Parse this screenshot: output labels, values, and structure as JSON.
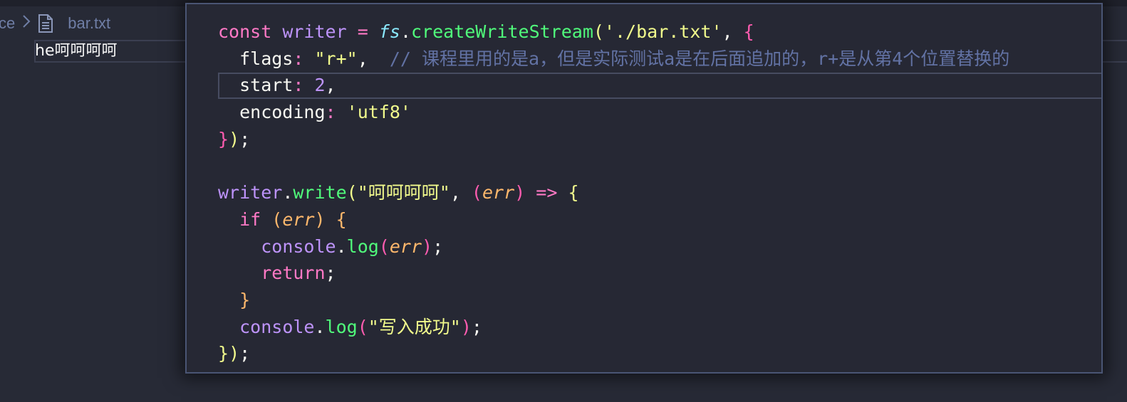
{
  "background_editor": {
    "breadcrumb_prev": "ce",
    "breadcrumb_file": "bar.txt",
    "file_content": "he呵呵呵呵"
  },
  "peek": {
    "lines": [
      {
        "tokens": [
          {
            "t": "const",
            "c": "kw"
          },
          {
            "t": " ",
            "c": "pun"
          },
          {
            "t": "writer",
            "c": "var"
          },
          {
            "t": " ",
            "c": "pun"
          },
          {
            "t": "=",
            "c": "op"
          },
          {
            "t": " ",
            "c": "pun"
          },
          {
            "t": "fs",
            "c": "obj"
          },
          {
            "t": ".",
            "c": "pun"
          },
          {
            "t": "createWriteStream",
            "c": "fn"
          },
          {
            "t": "(",
            "c": "p1"
          },
          {
            "t": "'./bar.txt'",
            "c": "str"
          },
          {
            "t": ", ",
            "c": "pun"
          },
          {
            "t": "{",
            "c": "p2"
          }
        ]
      },
      {
        "tokens": [
          {
            "t": "  flags",
            "c": "prop"
          },
          {
            "t": ":",
            "c": "op"
          },
          {
            "t": " ",
            "c": "pun"
          },
          {
            "t": "\"r+\"",
            "c": "str"
          },
          {
            "t": ",  ",
            "c": "pun"
          },
          {
            "t": "// 课程里用的是a，但是实际测试a是在后面追加的，r+是从第4个位置替换的",
            "c": "cmt"
          }
        ]
      },
      {
        "tokens": [
          {
            "t": "  start",
            "c": "prop"
          },
          {
            "t": ":",
            "c": "op"
          },
          {
            "t": " ",
            "c": "pun"
          },
          {
            "t": "2",
            "c": "num"
          },
          {
            "t": ",",
            "c": "pun"
          }
        ]
      },
      {
        "tokens": [
          {
            "t": "  encoding",
            "c": "prop"
          },
          {
            "t": ":",
            "c": "op"
          },
          {
            "t": " ",
            "c": "pun"
          },
          {
            "t": "'utf8'",
            "c": "str"
          }
        ]
      },
      {
        "tokens": [
          {
            "t": "}",
            "c": "p2"
          },
          {
            "t": ")",
            "c": "p1"
          },
          {
            "t": ";",
            "c": "pun"
          }
        ]
      },
      {
        "tokens": [
          {
            "t": "",
            "c": "pun"
          }
        ]
      },
      {
        "tokens": [
          {
            "t": "writer",
            "c": "var"
          },
          {
            "t": ".",
            "c": "pun"
          },
          {
            "t": "write",
            "c": "fn"
          },
          {
            "t": "(",
            "c": "p1"
          },
          {
            "t": "\"呵呵呵呵\"",
            "c": "str"
          },
          {
            "t": ", ",
            "c": "pun"
          },
          {
            "t": "(",
            "c": "p2"
          },
          {
            "t": "err",
            "c": "param"
          },
          {
            "t": ")",
            "c": "p2"
          },
          {
            "t": " ",
            "c": "pun"
          },
          {
            "t": "=>",
            "c": "op"
          },
          {
            "t": " ",
            "c": "pun"
          },
          {
            "t": "{",
            "c": "p1"
          }
        ]
      },
      {
        "tokens": [
          {
            "t": "  ",
            "c": "pun"
          },
          {
            "t": "if",
            "c": "kw"
          },
          {
            "t": " ",
            "c": "pun"
          },
          {
            "t": "(",
            "c": "p3"
          },
          {
            "t": "err",
            "c": "param"
          },
          {
            "t": ")",
            "c": "p3"
          },
          {
            "t": " ",
            "c": "pun"
          },
          {
            "t": "{",
            "c": "p3"
          }
        ]
      },
      {
        "tokens": [
          {
            "t": "    ",
            "c": "pun"
          },
          {
            "t": "console",
            "c": "var"
          },
          {
            "t": ".",
            "c": "pun"
          },
          {
            "t": "log",
            "c": "fn"
          },
          {
            "t": "(",
            "c": "p2"
          },
          {
            "t": "err",
            "c": "param"
          },
          {
            "t": ")",
            "c": "p2"
          },
          {
            "t": ";",
            "c": "pun"
          }
        ]
      },
      {
        "tokens": [
          {
            "t": "    ",
            "c": "pun"
          },
          {
            "t": "return",
            "c": "kw"
          },
          {
            "t": ";",
            "c": "pun"
          }
        ]
      },
      {
        "tokens": [
          {
            "t": "  ",
            "c": "pun"
          },
          {
            "t": "}",
            "c": "p3"
          }
        ]
      },
      {
        "tokens": [
          {
            "t": "  ",
            "c": "pun"
          },
          {
            "t": "console",
            "c": "var"
          },
          {
            "t": ".",
            "c": "pun"
          },
          {
            "t": "log",
            "c": "fn"
          },
          {
            "t": "(",
            "c": "p2"
          },
          {
            "t": "\"写入成功\"",
            "c": "str"
          },
          {
            "t": ")",
            "c": "p2"
          },
          {
            "t": ";",
            "c": "pun"
          }
        ]
      },
      {
        "tokens": [
          {
            "t": "}",
            "c": "p1"
          },
          {
            "t": ")",
            "c": "p1"
          },
          {
            "t": ";",
            "c": "pun"
          }
        ]
      }
    ]
  },
  "icons": {
    "breadcrumb_separator": "chevron-right-icon",
    "file": "file-text-icon"
  },
  "colors": {
    "background": "#272a36",
    "peek_border": "#4a5574",
    "keyword": "#ff79c6",
    "variable": "#bd93f9",
    "function": "#50fa7b",
    "string": "#f1fa8c",
    "comment": "#6272a4",
    "parameter": "#ffb86c"
  }
}
